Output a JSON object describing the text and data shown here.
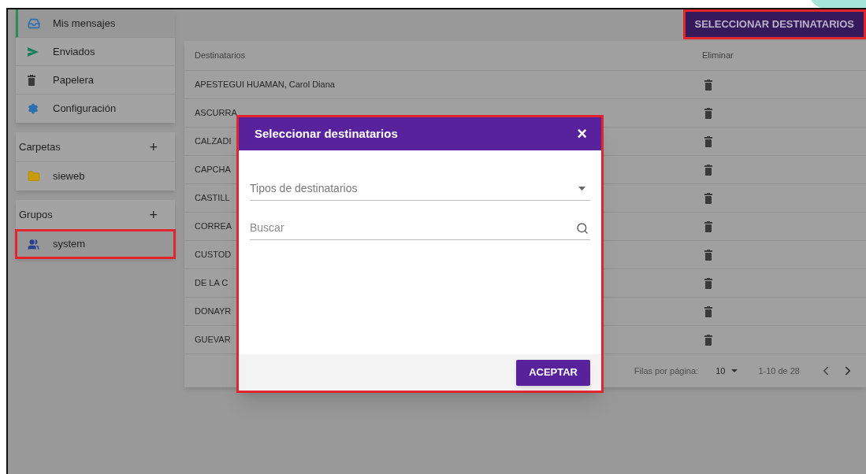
{
  "sidebar": {
    "menu": [
      {
        "kind": "inbox",
        "label": "Mis mensajes",
        "selected": true
      },
      {
        "kind": "send",
        "label": "Enviados",
        "selected": false
      },
      {
        "kind": "trash",
        "label": "Papelera",
        "selected": false
      },
      {
        "kind": "gear",
        "label": "Configuración",
        "selected": false
      }
    ],
    "sections": [
      {
        "title": "Carpetas",
        "add": "+",
        "items": [
          {
            "kind": "folder",
            "label": "sieweb",
            "selected": false
          }
        ]
      },
      {
        "title": "Grupos",
        "add": "+",
        "items": [
          {
            "kind": "group",
            "label": "system",
            "selected": true
          }
        ]
      }
    ]
  },
  "toolbar": {
    "button": "SELECCIONAR DESTINATARIOS"
  },
  "table": {
    "columns": [
      "Destinatarios",
      "Eliminar"
    ],
    "rows": [
      {
        "name": "APESTEGUI HUAMAN, Carol Diana"
      },
      {
        "name": "ASCURRA"
      },
      {
        "name": "CALZADI"
      },
      {
        "name": "CAPCHA"
      },
      {
        "name": "CASTILL"
      },
      {
        "name": "CORREA"
      },
      {
        "name": "CUSTOD"
      },
      {
        "name": "DE LA C"
      },
      {
        "name": "DONAYR"
      },
      {
        "name": "GUEVAR"
      }
    ],
    "pagination": {
      "rows_label": "Filas por página:",
      "rows_value": "10",
      "range": "1-10 de 28"
    }
  },
  "dialog": {
    "title": "Seleccionar destinatarios",
    "close": "×",
    "select_placeholder": "Tipos de destinatarios",
    "search_placeholder": "Buscar",
    "button": "ACEPTAR"
  }
}
